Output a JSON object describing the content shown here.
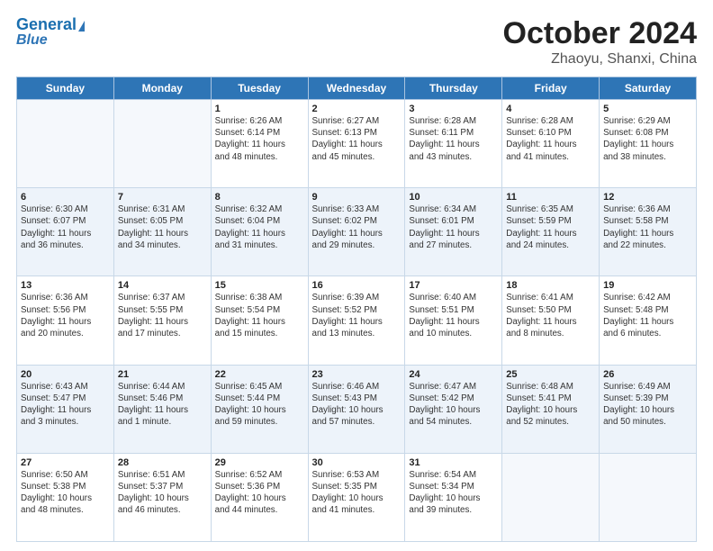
{
  "header": {
    "logo_line1": "General",
    "logo_line2": "Blue",
    "title": "October 2024",
    "subtitle": "Zhaoyu, Shanxi, China"
  },
  "days_of_week": [
    "Sunday",
    "Monday",
    "Tuesday",
    "Wednesday",
    "Thursday",
    "Friday",
    "Saturday"
  ],
  "weeks": [
    {
      "shade": false,
      "days": [
        {
          "num": "",
          "info": ""
        },
        {
          "num": "",
          "info": ""
        },
        {
          "num": "1",
          "info": "Sunrise: 6:26 AM\nSunset: 6:14 PM\nDaylight: 11 hours\nand 48 minutes."
        },
        {
          "num": "2",
          "info": "Sunrise: 6:27 AM\nSunset: 6:13 PM\nDaylight: 11 hours\nand 45 minutes."
        },
        {
          "num": "3",
          "info": "Sunrise: 6:28 AM\nSunset: 6:11 PM\nDaylight: 11 hours\nand 43 minutes."
        },
        {
          "num": "4",
          "info": "Sunrise: 6:28 AM\nSunset: 6:10 PM\nDaylight: 11 hours\nand 41 minutes."
        },
        {
          "num": "5",
          "info": "Sunrise: 6:29 AM\nSunset: 6:08 PM\nDaylight: 11 hours\nand 38 minutes."
        }
      ]
    },
    {
      "shade": true,
      "days": [
        {
          "num": "6",
          "info": "Sunrise: 6:30 AM\nSunset: 6:07 PM\nDaylight: 11 hours\nand 36 minutes."
        },
        {
          "num": "7",
          "info": "Sunrise: 6:31 AM\nSunset: 6:05 PM\nDaylight: 11 hours\nand 34 minutes."
        },
        {
          "num": "8",
          "info": "Sunrise: 6:32 AM\nSunset: 6:04 PM\nDaylight: 11 hours\nand 31 minutes."
        },
        {
          "num": "9",
          "info": "Sunrise: 6:33 AM\nSunset: 6:02 PM\nDaylight: 11 hours\nand 29 minutes."
        },
        {
          "num": "10",
          "info": "Sunrise: 6:34 AM\nSunset: 6:01 PM\nDaylight: 11 hours\nand 27 minutes."
        },
        {
          "num": "11",
          "info": "Sunrise: 6:35 AM\nSunset: 5:59 PM\nDaylight: 11 hours\nand 24 minutes."
        },
        {
          "num": "12",
          "info": "Sunrise: 6:36 AM\nSunset: 5:58 PM\nDaylight: 11 hours\nand 22 minutes."
        }
      ]
    },
    {
      "shade": false,
      "days": [
        {
          "num": "13",
          "info": "Sunrise: 6:36 AM\nSunset: 5:56 PM\nDaylight: 11 hours\nand 20 minutes."
        },
        {
          "num": "14",
          "info": "Sunrise: 6:37 AM\nSunset: 5:55 PM\nDaylight: 11 hours\nand 17 minutes."
        },
        {
          "num": "15",
          "info": "Sunrise: 6:38 AM\nSunset: 5:54 PM\nDaylight: 11 hours\nand 15 minutes."
        },
        {
          "num": "16",
          "info": "Sunrise: 6:39 AM\nSunset: 5:52 PM\nDaylight: 11 hours\nand 13 minutes."
        },
        {
          "num": "17",
          "info": "Sunrise: 6:40 AM\nSunset: 5:51 PM\nDaylight: 11 hours\nand 10 minutes."
        },
        {
          "num": "18",
          "info": "Sunrise: 6:41 AM\nSunset: 5:50 PM\nDaylight: 11 hours\nand 8 minutes."
        },
        {
          "num": "19",
          "info": "Sunrise: 6:42 AM\nSunset: 5:48 PM\nDaylight: 11 hours\nand 6 minutes."
        }
      ]
    },
    {
      "shade": true,
      "days": [
        {
          "num": "20",
          "info": "Sunrise: 6:43 AM\nSunset: 5:47 PM\nDaylight: 11 hours\nand 3 minutes."
        },
        {
          "num": "21",
          "info": "Sunrise: 6:44 AM\nSunset: 5:46 PM\nDaylight: 11 hours\nand 1 minute."
        },
        {
          "num": "22",
          "info": "Sunrise: 6:45 AM\nSunset: 5:44 PM\nDaylight: 10 hours\nand 59 minutes."
        },
        {
          "num": "23",
          "info": "Sunrise: 6:46 AM\nSunset: 5:43 PM\nDaylight: 10 hours\nand 57 minutes."
        },
        {
          "num": "24",
          "info": "Sunrise: 6:47 AM\nSunset: 5:42 PM\nDaylight: 10 hours\nand 54 minutes."
        },
        {
          "num": "25",
          "info": "Sunrise: 6:48 AM\nSunset: 5:41 PM\nDaylight: 10 hours\nand 52 minutes."
        },
        {
          "num": "26",
          "info": "Sunrise: 6:49 AM\nSunset: 5:39 PM\nDaylight: 10 hours\nand 50 minutes."
        }
      ]
    },
    {
      "shade": false,
      "days": [
        {
          "num": "27",
          "info": "Sunrise: 6:50 AM\nSunset: 5:38 PM\nDaylight: 10 hours\nand 48 minutes."
        },
        {
          "num": "28",
          "info": "Sunrise: 6:51 AM\nSunset: 5:37 PM\nDaylight: 10 hours\nand 46 minutes."
        },
        {
          "num": "29",
          "info": "Sunrise: 6:52 AM\nSunset: 5:36 PM\nDaylight: 10 hours\nand 44 minutes."
        },
        {
          "num": "30",
          "info": "Sunrise: 6:53 AM\nSunset: 5:35 PM\nDaylight: 10 hours\nand 41 minutes."
        },
        {
          "num": "31",
          "info": "Sunrise: 6:54 AM\nSunset: 5:34 PM\nDaylight: 10 hours\nand 39 minutes."
        },
        {
          "num": "",
          "info": ""
        },
        {
          "num": "",
          "info": ""
        }
      ]
    }
  ]
}
